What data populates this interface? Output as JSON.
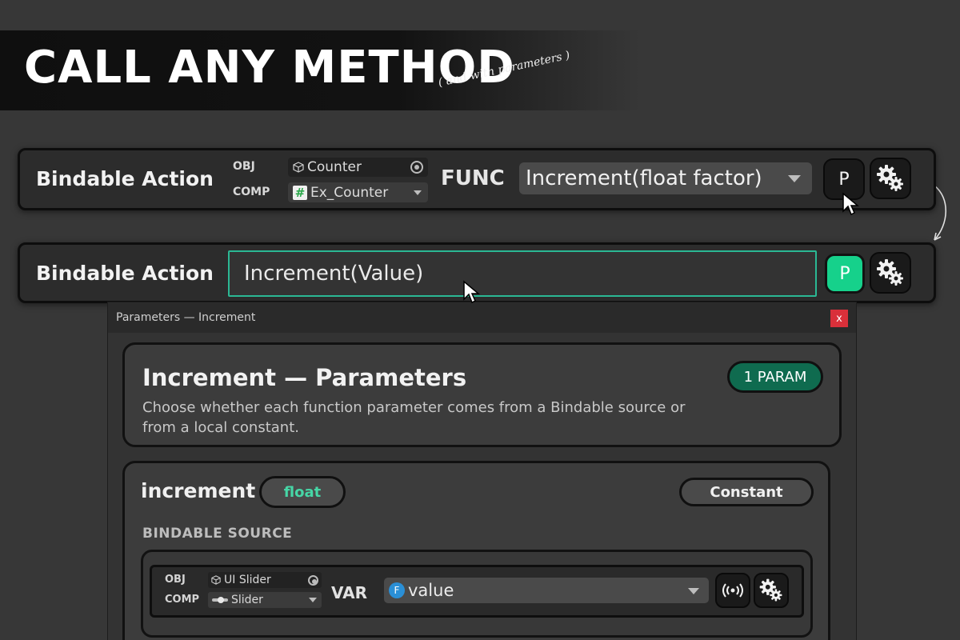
{
  "hero": {
    "title": "CALL ANY METHOD",
    "subtitle": "( and with parameters )"
  },
  "action_bar": {
    "title": "Bindable Action",
    "obj_label": "OBJ",
    "obj_value": "Counter",
    "comp_label": "COMP",
    "comp_value": "Ex_Counter",
    "func_label": "FUNC",
    "func_value": "Increment(float factor)",
    "params_button": "P"
  },
  "action_bar_collapsed": {
    "title": "Bindable Action",
    "expression": "Increment(Value)",
    "params_button": "P"
  },
  "params_window": {
    "title": "Parameters — Increment",
    "close_label": "x",
    "header": {
      "title": "Increment — Parameters",
      "description": "Choose whether each function parameter comes from a Bindable source or from a local constant.",
      "badge": "1 PARAM"
    },
    "parameter": {
      "name": "increment",
      "type": "float",
      "mode_button": "Constant",
      "section_label": "BINDABLE SOURCE",
      "source": {
        "obj_label": "OBJ",
        "obj_value": "UI Slider",
        "comp_label": "COMP",
        "comp_value": "Slider",
        "var_label": "VAR",
        "var_badge": "F",
        "var_value": "value"
      }
    }
  },
  "colors": {
    "accent_green": "#16d18b",
    "badge_green": "#0f6b4f",
    "type_green": "#46d6a6",
    "close_red": "#d9303a",
    "float_blue": "#2a8fd6"
  },
  "icons": [
    "cube-icon",
    "hash-icon",
    "target-icon",
    "gear-icon",
    "cursor-icon",
    "broadcast-icon",
    "slider-icon",
    "curved-arrow-icon"
  ]
}
